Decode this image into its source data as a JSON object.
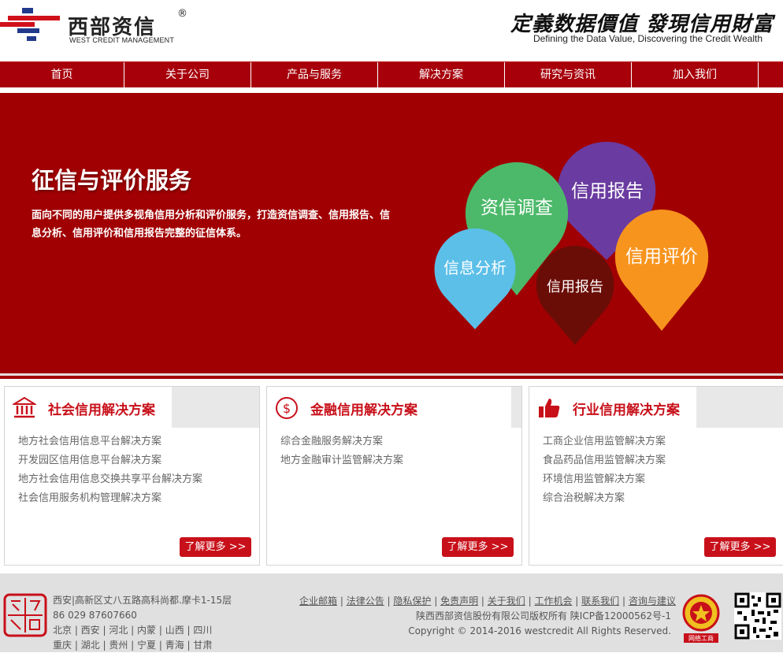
{
  "header": {
    "logo_cn": "西部资信",
    "logo_reg": "®",
    "logo_en": "WEST CREDIT MANAGEMENT",
    "slogan_cn": "定義数据價值 發現信用財富",
    "slogan_en": "Defining the Data Value, Discovering the Credit Wealth"
  },
  "nav": {
    "items": [
      "首页",
      "关于公司",
      "产品与服务",
      "解决方案",
      "研究与资讯",
      "加入我们"
    ]
  },
  "banner": {
    "title": "征信与评价服务",
    "desc": "面向不同的用户提供多视角信用分析和评价服务，打造资信调查、信用报告、信息分析、信用评价和信用报告完整的征信体系。",
    "bubbles": [
      {
        "label": "资信调查",
        "color": "#4caf50"
      },
      {
        "label": "信用报告",
        "color": "#6a3ba0"
      },
      {
        "label": "信用评价",
        "color": "#f7941d"
      },
      {
        "label": "信息分析",
        "color": "#5bbfe8"
      },
      {
        "label": "信用报告",
        "color": "#6b0d07"
      }
    ]
  },
  "cards": [
    {
      "title": "社会信用解决方案",
      "icon": "bank-icon",
      "items": [
        "地方社会信用信息平台解决方案",
        "开发园区信用信息平台解决方案",
        "地方社会信用信息交换共享平台解决方案",
        "社会信用服务机构管理解决方案"
      ],
      "more": "了解更多 >>"
    },
    {
      "title": "金融信用解决方案",
      "icon": "dollar-icon",
      "items": [
        "综合金融服务解决方案",
        "地方金融审计监管解决方案"
      ],
      "more": "了解更多 >>"
    },
    {
      "title": "行业信用解决方案",
      "icon": "thumbs-up-icon",
      "items": [
        "工商企业信用监管解决方案",
        "食品药品信用监管解决方案",
        "环境信用监管解决方案",
        "综合治税解决方案"
      ],
      "more": "了解更多 >>"
    }
  ],
  "footer": {
    "address_lines": [
      "西安|高新区丈八五路高科尚都.摩卡1-15层",
      "86 029 87607660",
      "北京 | 西安 | 河北 | 内蒙 | 山西 | 四川",
      "重庆 | 湖北 | 贵州 | 宁夏 | 青海 | 甘肃"
    ],
    "links": [
      "企业邮箱",
      "法律公告",
      "隐私保护",
      "免责声明",
      "关于我们",
      "工作机会",
      "联系我们",
      "咨询与建议"
    ],
    "company": "陕西西部资信股份有限公司版权所有 陕ICP备12000562号-1",
    "copyright": "Copyright © 2014-2016 westcredit All Rights Reserved.",
    "badge_label": "网络工商"
  },
  "colors": {
    "brand_red": "#a7000b",
    "accent_red": "#c8101a"
  }
}
